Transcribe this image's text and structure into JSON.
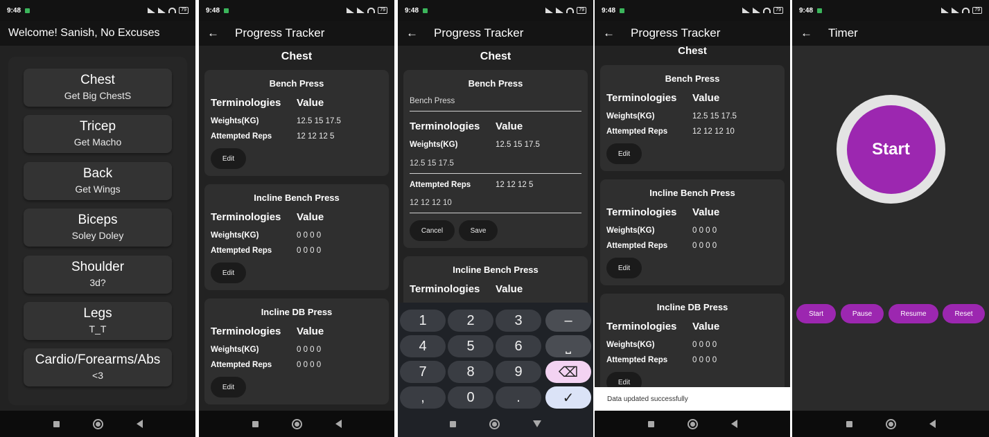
{
  "status": {
    "time": "9:48",
    "battery": "79"
  },
  "screen1": {
    "title": "Welcome! Sanish, No Excuses",
    "categories": [
      {
        "name": "Chest",
        "sub": "Get Big ChestS"
      },
      {
        "name": "Tricep",
        "sub": "Get Macho"
      },
      {
        "name": "Back",
        "sub": "Get Wings"
      },
      {
        "name": "Biceps",
        "sub": "Soley Doley"
      },
      {
        "name": "Shoulder",
        "sub": "3d?"
      },
      {
        "name": "Legs",
        "sub": "T_T"
      },
      {
        "name": "Cardio/Forearms/Abs",
        "sub": "<3"
      }
    ]
  },
  "tracker": {
    "title": "Progress Tracker",
    "section": "Chest",
    "col_term": "Terminologies",
    "col_value": "Value",
    "label_weights": "Weights(KG)",
    "label_reps": "Attempted Reps",
    "edit": "Edit",
    "cancel": "Cancel",
    "save": "Save"
  },
  "screen2": {
    "exercises": [
      {
        "name": "Bench Press",
        "weights": "12.5 15 17.5",
        "reps": "12 12 12 5"
      },
      {
        "name": "Incline Bench Press",
        "weights": "0 0 0 0",
        "reps": "0 0 0 0"
      },
      {
        "name": "Incline DB Press",
        "weights": "0 0 0 0",
        "reps": "0 0 0 0"
      }
    ]
  },
  "screen3": {
    "edit_card": {
      "name": "Bench Press",
      "name_field": "Bench Press",
      "weights": "12.5 15 17.5",
      "weights_field": "12.5 15 17.5",
      "reps": "12 12 12 5",
      "reps_field": "12 12 12 10"
    },
    "next_card": {
      "name": "Incline Bench Press"
    },
    "keys": [
      "1",
      "2",
      "3",
      "–",
      "4",
      "5",
      "6",
      "⎵",
      "7",
      "8",
      "9",
      "⌫",
      ",",
      "0",
      ".",
      "✓"
    ]
  },
  "screen4": {
    "exercises": [
      {
        "name": "Bench Press",
        "weights": "12.5 15 17.5",
        "reps": "12 12 12 10"
      },
      {
        "name": "Incline Bench Press",
        "weights": "0 0 0 0",
        "reps": "0 0 0 0"
      },
      {
        "name": "Incline DB Press",
        "weights": "0 0 0 0",
        "reps": "0 0 0 0"
      }
    ],
    "toast": "Data updated successfully"
  },
  "screen5": {
    "title": "Timer",
    "circle_label": "Start",
    "buttons": [
      "Start",
      "Pause",
      "Resume",
      "Reset"
    ]
  },
  "colors": {
    "accent": "#9c27b0",
    "background": "#222222",
    "card": "#2f2f2f",
    "appbar": "#141414"
  }
}
